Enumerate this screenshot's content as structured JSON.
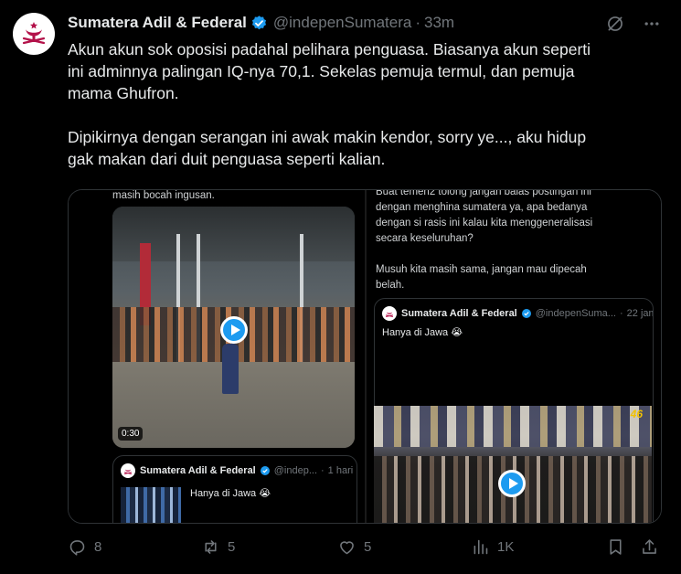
{
  "post": {
    "author_name": "Sumatera Adil & Federal",
    "author_handle": "@indepenSumatera",
    "separator": "·",
    "time": "33m",
    "paragraph_1": "Akun akun sok oposisi padahal pelihara penguasa. Biasanya akun seperti\nini adminnya palingan IQ-nya 70,1. Sekelas pemuja termul, dan pemuja\nmama Ghufron.",
    "paragraph_2": "Dipikirnya dengan serangan ini awak makin kendor, sorry ye..., aku hidup\ngak makan dari duit penguasa seperti kalian."
  },
  "media": {
    "left": {
      "top_text": "masih bocah ingusan.",
      "video_duration": "0:30",
      "quote": {
        "name": "Sumatera Adil & Federal",
        "handle": "@indep...",
        "separator": "·",
        "time": "1 hari",
        "text": "Hanya di Jawa 😭"
      }
    },
    "right": {
      "text_1": "Buat temen2 tolong jangan balas postingan ini\ndengan menghina sumatera ya, apa bedanya\ndengan si rasis ini kalau kita menggeneralisasi\nsecara keseluruhan?",
      "text_2": "Musuh kita masih sama, jangan mau dipecah\nbelah.",
      "quote": {
        "name": "Sumatera Adil & Federal",
        "handle": "@indepenSuma...",
        "separator": "·",
        "time": "22 jam",
        "text": "Hanya di Jawa 😭",
        "overlay_logo": "46"
      }
    }
  },
  "actions": {
    "replies": "8",
    "reposts": "5",
    "likes": "5",
    "views": "1K"
  },
  "colors": {
    "background": "#000000",
    "text": "#e7e9ea",
    "muted": "#71767b",
    "accent": "#1d9bf0",
    "border": "#2f3336",
    "logo_red": "#b3124a"
  },
  "icons": [
    "grok-slash-icon",
    "more-icon",
    "verified-icon",
    "play-icon",
    "reply-icon",
    "repost-icon",
    "like-icon",
    "views-icon",
    "bookmark-icon",
    "share-icon"
  ]
}
